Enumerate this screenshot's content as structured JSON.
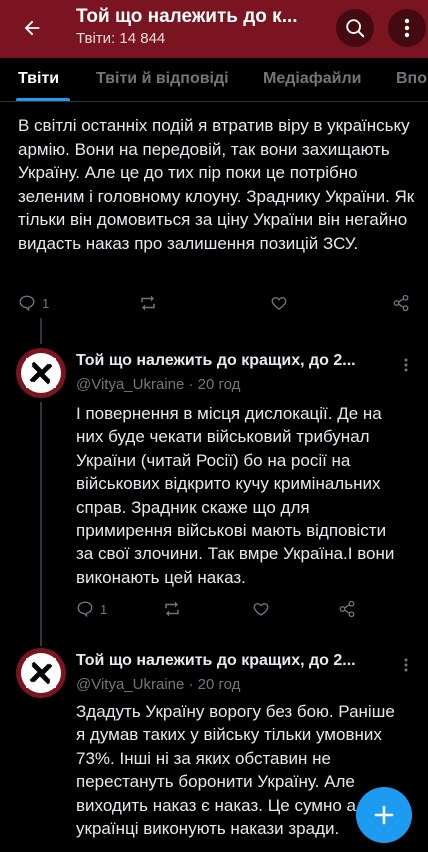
{
  "header": {
    "title": "Той що належить до к...",
    "subtitle": "Твіти: 14 844"
  },
  "tabs": [
    {
      "label": "Твіти",
      "active": true
    },
    {
      "label": "Твіти й відповіді",
      "active": false
    },
    {
      "label": "Медіафайли",
      "active": false
    },
    {
      "label": "Впо",
      "active": false
    }
  ],
  "main_tweet": {
    "text": "В світлі останніх подій я втратив віру в українську армію. Вони на передовій, так вони захищають Україну. Але це до тих пір поки це потрібно зеленим і головному клоуну. Зраднику України. Як тільки він домовиться за ціну України він негайно видасть наказ про залишення позицій ЗСУ.",
    "reply_count": "1"
  },
  "replies": [
    {
      "name": "Той що належить до кращих, до 2...",
      "handle": "@Vitya_Ukraine · 20 год",
      "text": "І повернення  в місця дислокації. Де на них буде чекати військовий трибунал України (читай Росії) бо на росії на військових відкрито кучу кримінальних справ. Зрадник скаже що для примирення військові мають відповісти за свої злочини. Так вмре Україна.І  вони виконають цей наказ.",
      "reply_count": "1"
    },
    {
      "name": "Той що належить до кращих, до 2...",
      "handle": "@Vitya_Ukraine · 20 год",
      "text": "Здадуть Україну ворогу без бою. Раніше я думав таких у війську тільки умовних 73%. Інші ні за яких обставин не перестануть боронити Україну. Але виходить наказ є наказ. Це сумно але українці виконують накази зради."
    }
  ],
  "colors": {
    "header_bg": "#7a1420",
    "accent": "#1d9bf0",
    "muted": "#71767b"
  }
}
